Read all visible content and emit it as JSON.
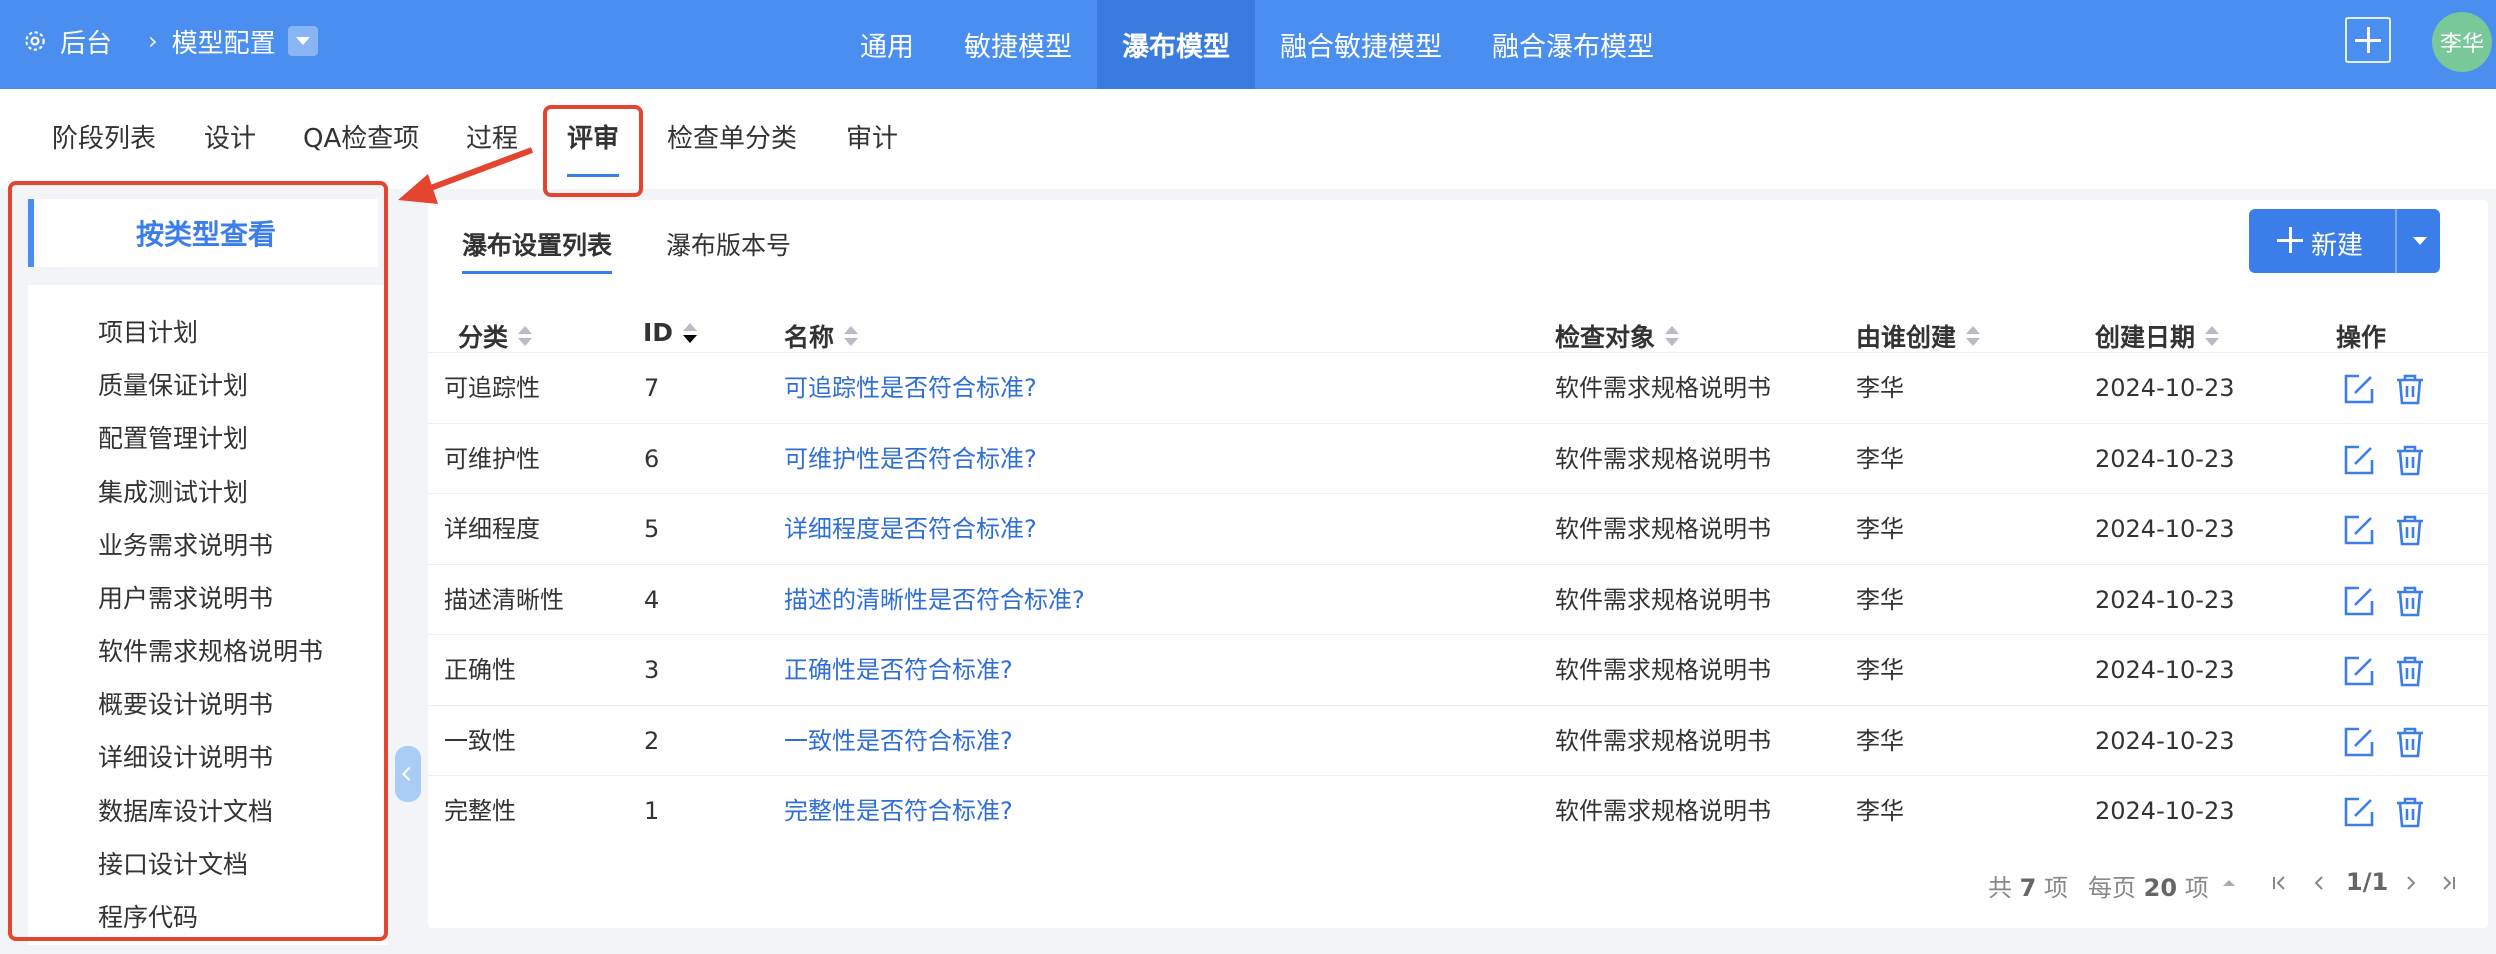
{
  "topbar": {
    "home": "后台",
    "crumb_sep": "›",
    "current": "模型配置",
    "nav": [
      "通用",
      "敏捷模型",
      "瀑布模型",
      "融合敏捷模型",
      "融合瀑布模型"
    ],
    "active_nav": 2,
    "avatar": "李华"
  },
  "subtabs": [
    "阶段列表",
    "设计",
    "QA检查项",
    "过程",
    "评审",
    "检查单分类",
    "审计"
  ],
  "active_subtab": 4,
  "sidebar": {
    "title": "按类型查看",
    "items": [
      "项目计划",
      "质量保证计划",
      "配置管理计划",
      "集成测试计划",
      "业务需求说明书",
      "用户需求说明书",
      "软件需求规格说明书",
      "概要设计说明书",
      "详细设计说明书",
      "数据库设计文档",
      "接口设计文档",
      "程序代码"
    ]
  },
  "main": {
    "tabs": [
      "瀑布设置列表",
      "瀑布版本号"
    ],
    "new_button": "新建",
    "columns": [
      "分类",
      "ID",
      "名称",
      "检查对象",
      "由谁创建",
      "创建日期",
      "操作"
    ],
    "rows": [
      {
        "category": "可追踪性",
        "id": "7",
        "name": "可追踪性是否符合标准?",
        "target": "软件需求规格说明书",
        "creator": "李华",
        "date": "2024-10-23"
      },
      {
        "category": "可维护性",
        "id": "6",
        "name": "可维护性是否符合标准?",
        "target": "软件需求规格说明书",
        "creator": "李华",
        "date": "2024-10-23"
      },
      {
        "category": "详细程度",
        "id": "5",
        "name": "详细程度是否符合标准?",
        "target": "软件需求规格说明书",
        "creator": "李华",
        "date": "2024-10-23"
      },
      {
        "category": "描述清晰性",
        "id": "4",
        "name": "描述的清晰性是否符合标准?",
        "target": "软件需求规格说明书",
        "creator": "李华",
        "date": "2024-10-23"
      },
      {
        "category": "正确性",
        "id": "3",
        "name": "正确性是否符合标准?",
        "target": "软件需求规格说明书",
        "creator": "李华",
        "date": "2024-10-23"
      },
      {
        "category": "一致性",
        "id": "2",
        "name": "一致性是否符合标准?",
        "target": "软件需求规格说明书",
        "creator": "李华",
        "date": "2024-10-23"
      },
      {
        "category": "完整性",
        "id": "1",
        "name": "完整性是否符合标准?",
        "target": "软件需求规格说明书",
        "creator": "李华",
        "date": "2024-10-23"
      }
    ],
    "pager": {
      "total_prefix": "共",
      "total": "7",
      "total_suffix": "项",
      "per_page_prefix": "每页",
      "per_page": "20",
      "per_page_suffix": "项",
      "page": "1/1"
    }
  },
  "colors": {
    "primary": "#4a8ef0",
    "accent": "#3b7de9",
    "highlight": "#e5442f",
    "link": "#2f6ed6"
  }
}
